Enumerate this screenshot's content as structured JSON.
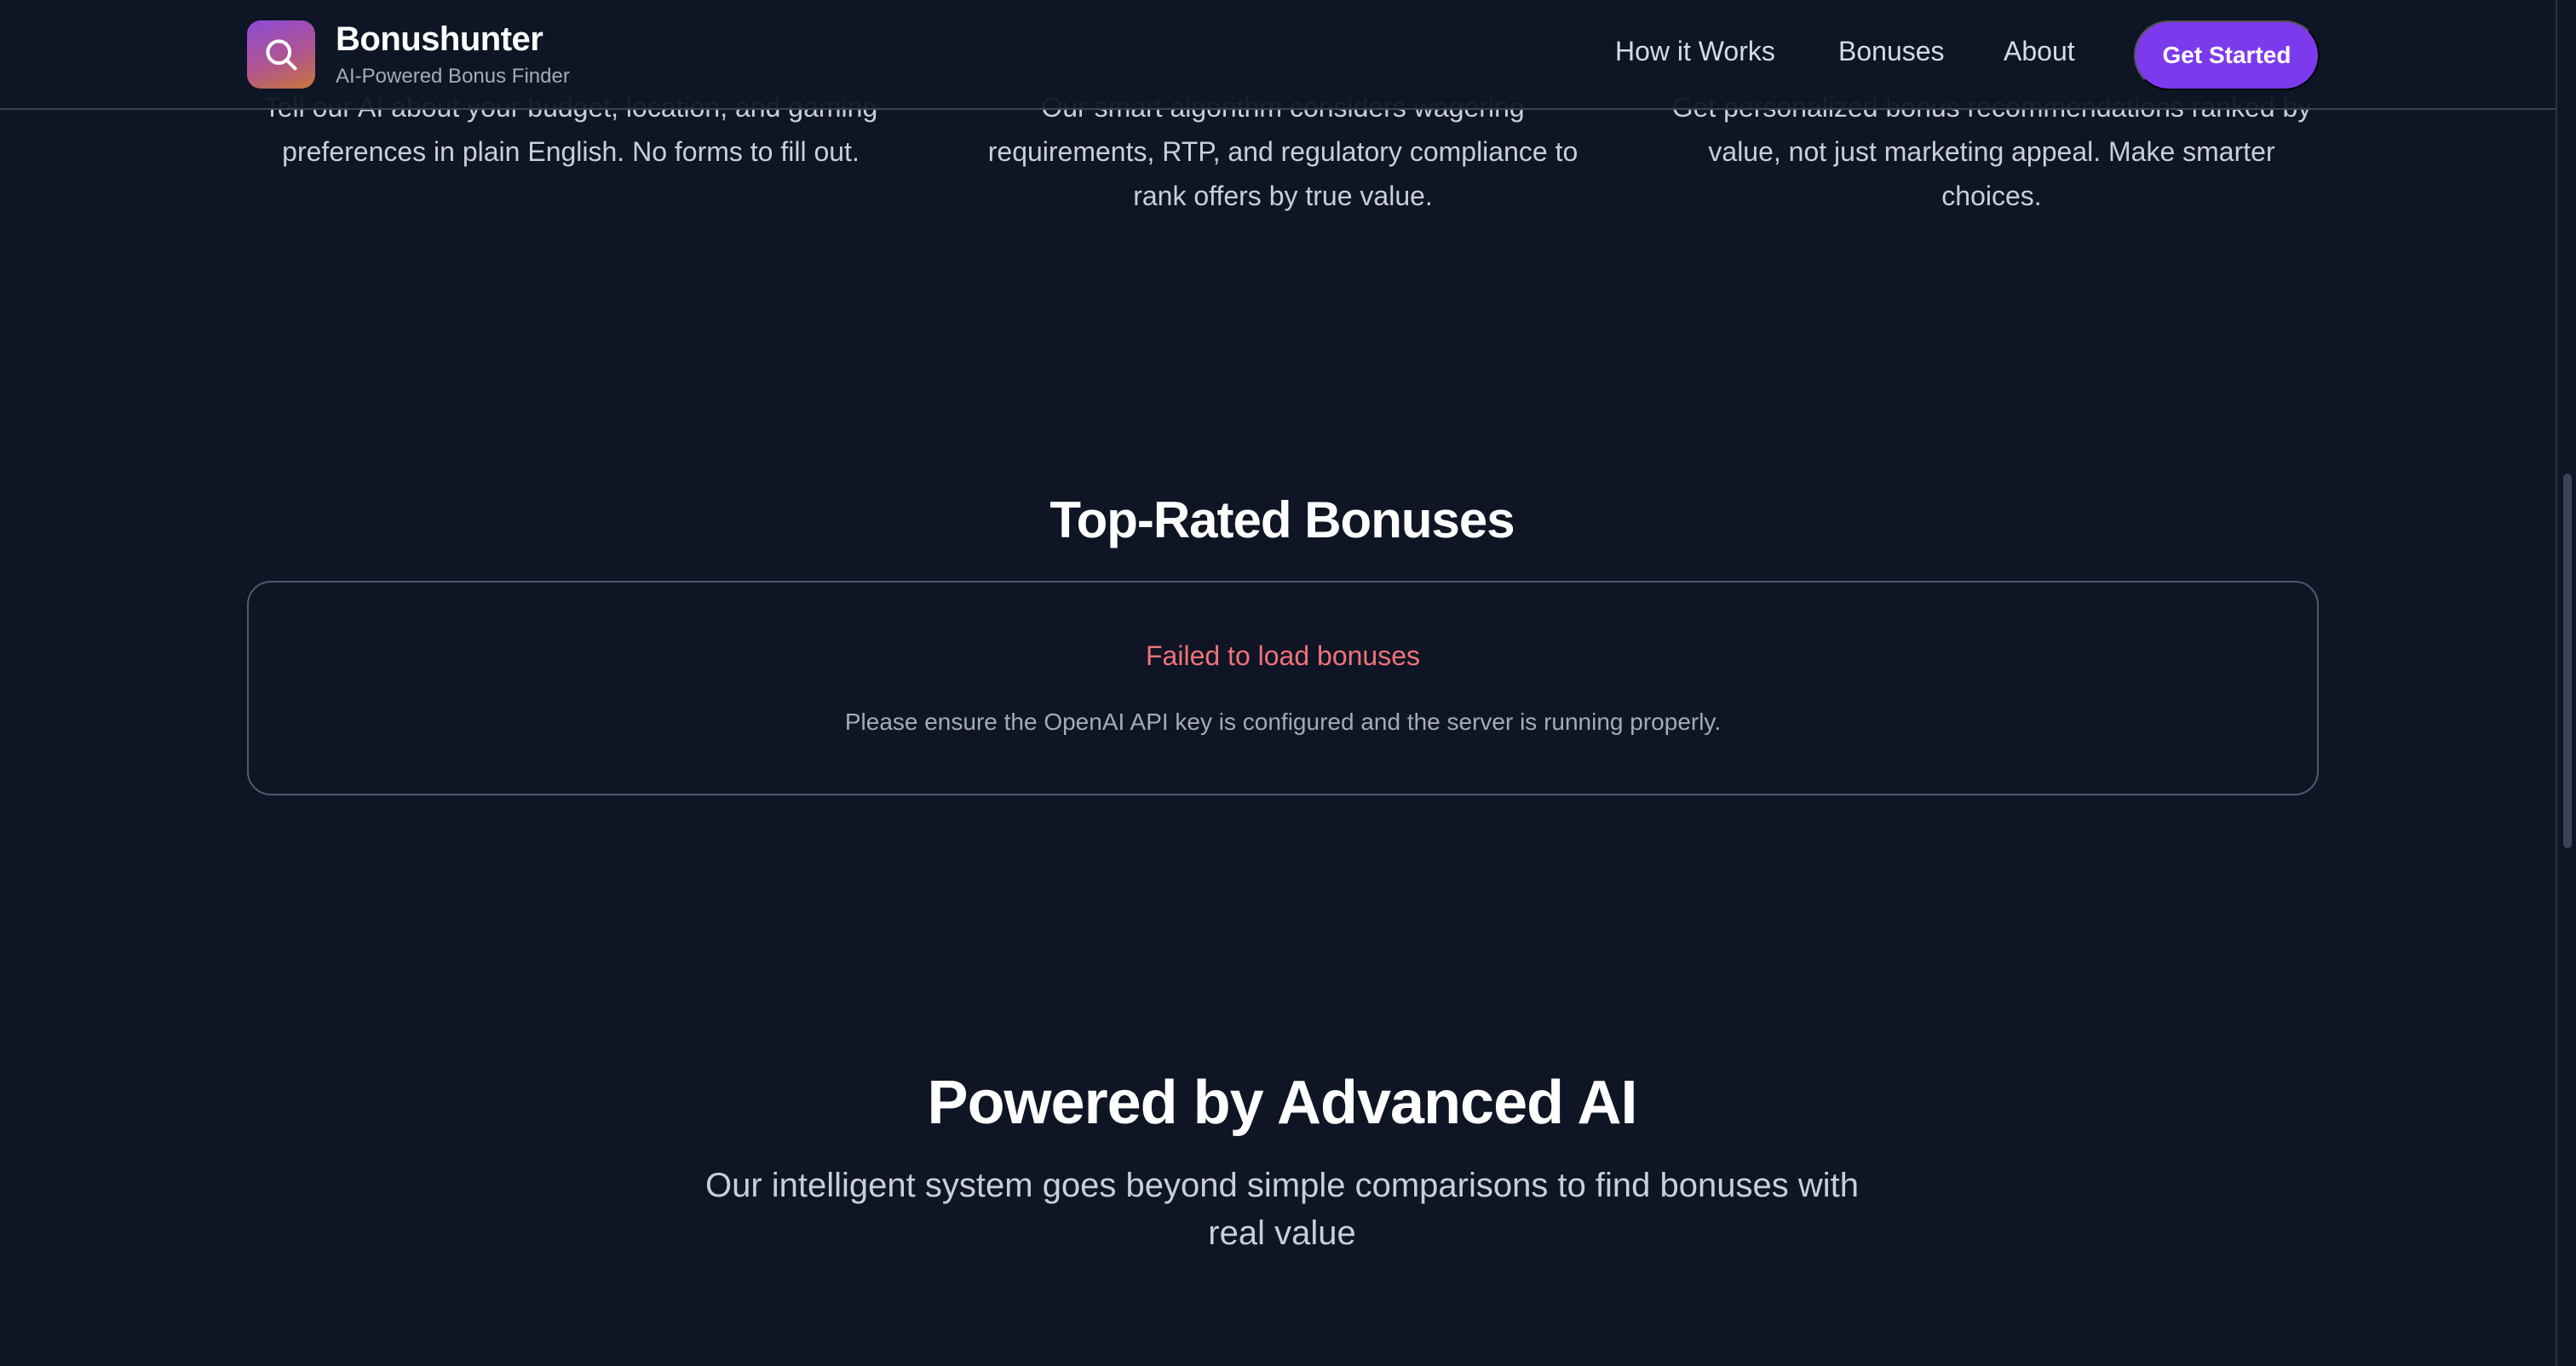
{
  "header": {
    "brand_name": "Bonushunter",
    "brand_tagline": "AI-Powered Bonus Finder",
    "nav": [
      "How it Works",
      "Bonuses",
      "About"
    ],
    "cta_label": "Get Started"
  },
  "features": [
    {
      "text": "Tell our AI about your budget, location, and gaming preferences in plain English. No forms to fill out."
    },
    {
      "text": "Our smart algorithm considers wagering requirements, RTP, and regulatory compliance to rank offers by true value."
    },
    {
      "text": "Get personalized bonus recommendations ranked by value, not just marketing appeal. Make smarter choices."
    }
  ],
  "top_rated": {
    "title": "Top-Rated Bonuses",
    "error_title": "Failed to load bonuses",
    "error_message": "Please ensure the OpenAI API key is configured and the server is running properly."
  },
  "powered": {
    "title": "Powered by Advanced AI",
    "subtitle": "Our intelligent system goes beyond simple comparisons to find bonuses with real value"
  },
  "colors": {
    "background": "#0f1524",
    "accent": "#7c3aed",
    "error": "#f0727a"
  }
}
